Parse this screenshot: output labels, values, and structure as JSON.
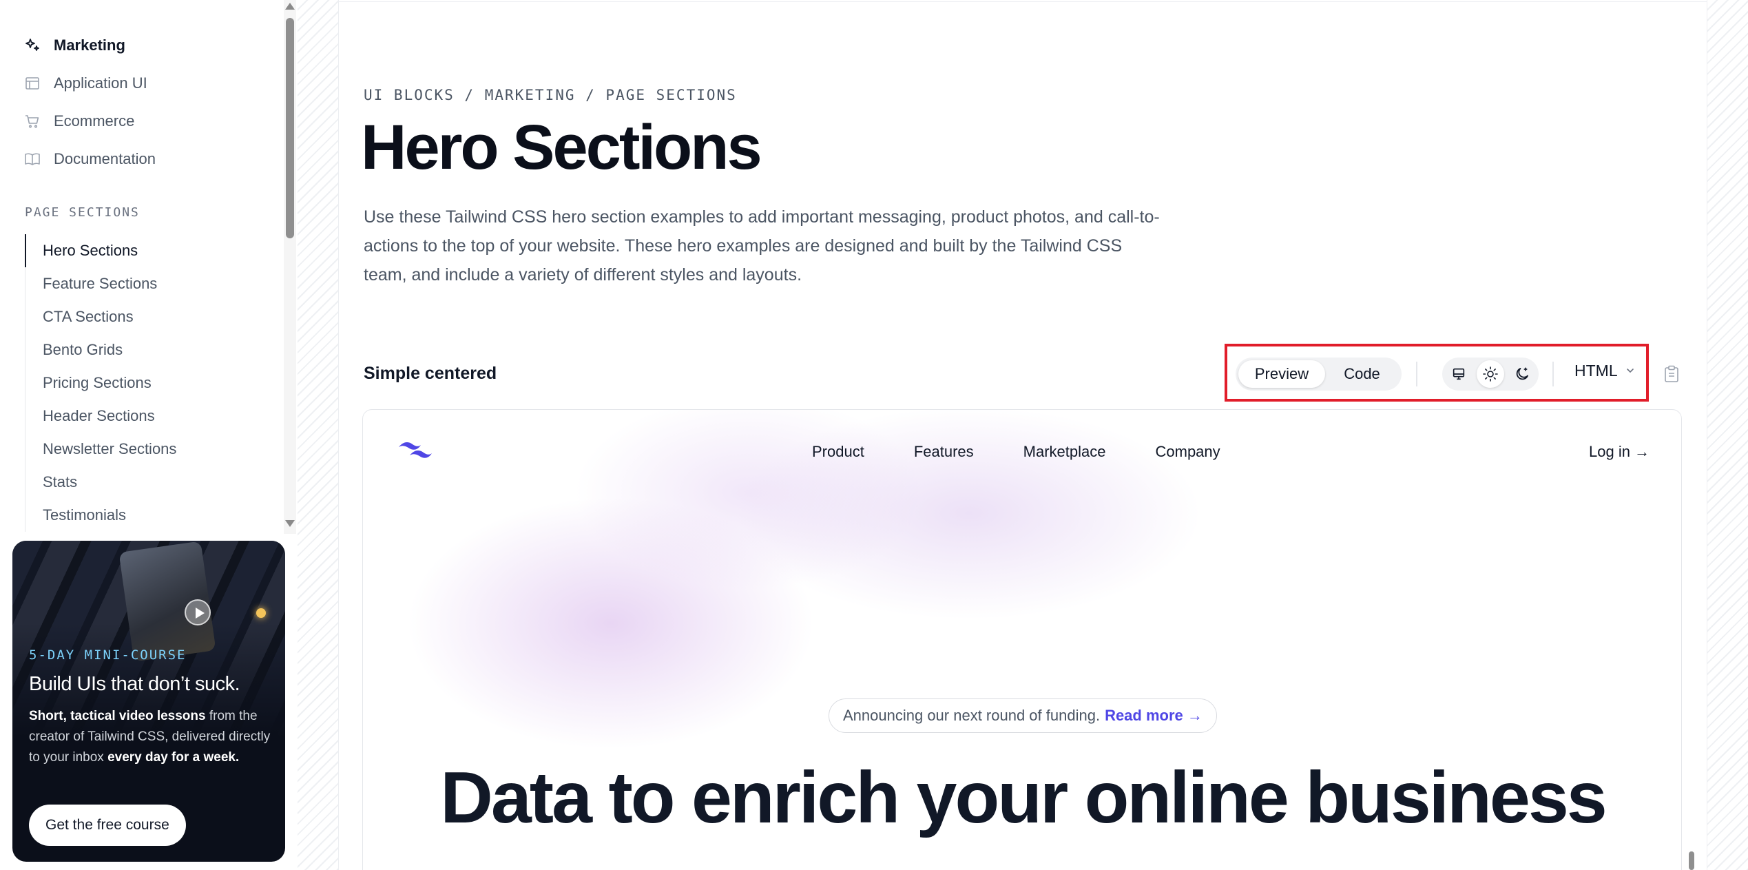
{
  "sidebar": {
    "top_items": [
      {
        "label": "Marketing",
        "icon": "sparkles-icon"
      },
      {
        "label": "Application UI",
        "icon": "layout-icon"
      },
      {
        "label": "Ecommerce",
        "icon": "cart-icon"
      },
      {
        "label": "Documentation",
        "icon": "book-icon"
      }
    ],
    "section_heading": "PAGE SECTIONS",
    "sub_items": [
      "Hero Sections",
      "Feature Sections",
      "CTA Sections",
      "Bento Grids",
      "Pricing Sections",
      "Header Sections",
      "Newsletter Sections",
      "Stats",
      "Testimonials"
    ],
    "active_sub_item": "Hero Sections"
  },
  "promo": {
    "eyebrow": "5-DAY MINI-COURSE",
    "title": "Build UIs that don’t suck.",
    "body_bold_1": "Short, tactical video lessons",
    "body_text_1": " from the creator of Tailwind CSS, delivered directly to your inbox ",
    "body_bold_2": "every day for a week.",
    "cta": "Get the free course"
  },
  "main": {
    "breadcrumb": "UI BLOCKS / MARKETING / PAGE SECTIONS",
    "title": "Hero Sections",
    "description": "Use these Tailwind CSS hero section examples to add important messaging, product photos, and call-to-actions to the top of your website. These hero examples are designed and built by the Tailwind CSS team, and include a variety of different styles and layouts."
  },
  "example": {
    "name": "Simple centered",
    "tabs": [
      "Preview",
      "Code"
    ],
    "selected_tab": "Preview",
    "view_icons": [
      "monitor-icon",
      "sun-icon",
      "moon-icon"
    ],
    "selected_view": "sun-icon",
    "language": "HTML",
    "copy_icon": "clipboard-icon"
  },
  "preview": {
    "nav": [
      "Product",
      "Features",
      "Marketplace",
      "Company"
    ],
    "login": "Log in →",
    "announcement": "Announcing our next round of funding.",
    "announcement_link": "Read more →",
    "headline": "Data to enrich your online business"
  },
  "colors": {
    "accent": "#4f46e5",
    "highlight_border": "#e11d2a",
    "promo_bg": "#0b0f1a",
    "promo_eyebrow": "#7dd3fc"
  }
}
